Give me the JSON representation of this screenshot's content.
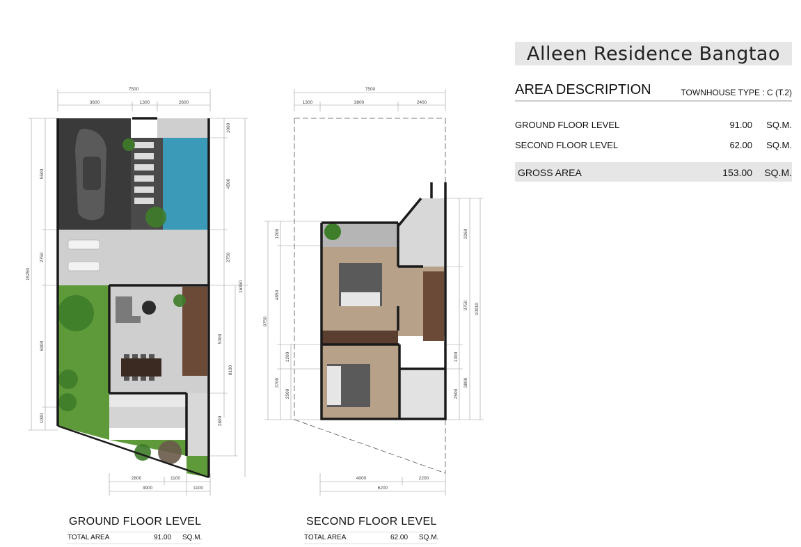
{
  "title": "Alleen Residence Bangtao",
  "area": {
    "heading": "AREA DESCRIPTION",
    "type": "TOWNHOUSE TYPE : C (T.2)",
    "rows": [
      {
        "label": "GROUND FLOOR LEVEL",
        "value": "91.00",
        "unit": "SQ.M."
      },
      {
        "label": "SECOND FLOOR LEVEL",
        "value": "62.00",
        "unit": "SQ.M."
      }
    ],
    "gross": {
      "label": "GROSS AREA",
      "value": "153.00",
      "unit": "SQ.M."
    }
  },
  "ground": {
    "label": "GROUND FLOOR LEVEL",
    "total_label": "TOTAL AREA",
    "total_value": "91.00",
    "total_unit": "SQ.M.",
    "dims": {
      "top_total": "7500",
      "top_a": "3600",
      "top_b": "1300",
      "top_c": "2600",
      "left_total": "15250",
      "left_a": "5500",
      "left_b": "2750",
      "left_c": "6000",
      "left_d": "1000",
      "right_a": "1000",
      "right_b": "4500",
      "right_c": "2750",
      "right_d": "5300",
      "right_e": "2800",
      "right_f": "8100",
      "right_total": "16350",
      "bot_a": "2800",
      "bot_b": "1100",
      "bot_c": "3900",
      "bot_d": "1100"
    }
  },
  "second": {
    "label": "SECOND FLOOR LEVEL",
    "total_label": "TOTAL AREA",
    "total_value": "62.00",
    "total_unit": "SQ.M.",
    "dims": {
      "top_total": "7500",
      "top_a": "1300",
      "top_b": "3800",
      "top_c": "2400",
      "left_total": "9750",
      "left_a": "1200",
      "left_b": "4850",
      "left_c": "1200",
      "left_d": "3700",
      "left_e": "2500",
      "right_a": "3360",
      "right_b": "3750",
      "right_c": "1300",
      "right_d": "3800",
      "right_e": "2500",
      "right_total": "10910",
      "bot_a": "4000",
      "bot_b": "2200",
      "bot_c": "6200"
    }
  },
  "colors": {
    "wall": "#1a1a1a",
    "pool": "#3a9ab8",
    "garden": "#5e9a3a",
    "floor": "#cfcfcf",
    "wood": "#b39a7e",
    "title_bg": "#e6e6e6"
  }
}
